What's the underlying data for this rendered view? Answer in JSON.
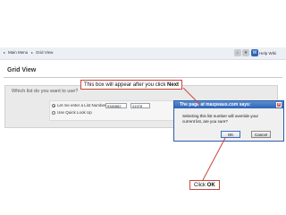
{
  "breadcrumb": {
    "items": [
      "Main Menu",
      "Grid View"
    ]
  },
  "toolbar": {
    "help_label": "Help Wiki"
  },
  "page": {
    "title": "Grid View",
    "question": "Which list do you want to use?"
  },
  "options": [
    {
      "label": "Let me enter a List Number",
      "selected": true,
      "inputs": [
        "9380882",
        "41978"
      ]
    },
    {
      "label": "Use Quick Look Up",
      "selected": false
    }
  ],
  "callouts": {
    "top": {
      "text": "This box will appear after you click ",
      "emphasis": "Next"
    },
    "bottom": {
      "text": "Click ",
      "emphasis": "OK"
    }
  },
  "dialog": {
    "title": "The page at maxpeaus.com says:",
    "message": "Selecting this list number will override your current list, are you sure?",
    "ok_label": "OK",
    "cancel_label": "Cancel"
  },
  "colors": {
    "callout_border": "#c9463d",
    "dialog_title": "#2f63b4",
    "panel": "#eaeaea"
  }
}
